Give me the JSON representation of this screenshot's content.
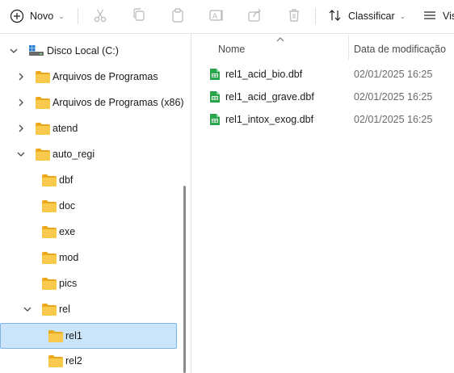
{
  "toolbar": {
    "new_label": "Novo",
    "sort_label": "Classificar",
    "view_label": "Vis",
    "icons": [
      "plus-circle-icon",
      "scissors-icon",
      "copy-icon",
      "paste-icon",
      "rename-icon",
      "share-icon",
      "trash-icon",
      "sort-icon",
      "view-icon"
    ]
  },
  "nav": {
    "drive_label": "Disco Local (C:)",
    "items": [
      {
        "label": "Arquivos de Programas",
        "expanded": false
      },
      {
        "label": "Arquivos de Programas (x86)",
        "expanded": false
      },
      {
        "label": "atend",
        "expanded": false
      },
      {
        "label": "auto_regi",
        "expanded": true
      },
      {
        "label": "dbf"
      },
      {
        "label": "doc"
      },
      {
        "label": "exe"
      },
      {
        "label": "mod"
      },
      {
        "label": "pics"
      },
      {
        "label": "rel",
        "expanded": true
      },
      {
        "label": "rel1",
        "selected": true
      },
      {
        "label": "rel2"
      }
    ]
  },
  "content": {
    "columns": {
      "name": "Nome",
      "date": "Data de modificação"
    },
    "files": [
      {
        "name": "rel1_acid_bio.dbf",
        "date": "02/01/2025 16:25"
      },
      {
        "name": "rel1_acid_grave.dbf",
        "date": "02/01/2025 16:25"
      },
      {
        "name": "rel1_intox_exog.dbf",
        "date": "02/01/2025 16:25"
      }
    ]
  },
  "colors": {
    "selection_bg": "#cce4f7",
    "selection_border": "#7cb4e3",
    "folder": "#f8c94a",
    "file_icon": "#2aa44a"
  }
}
